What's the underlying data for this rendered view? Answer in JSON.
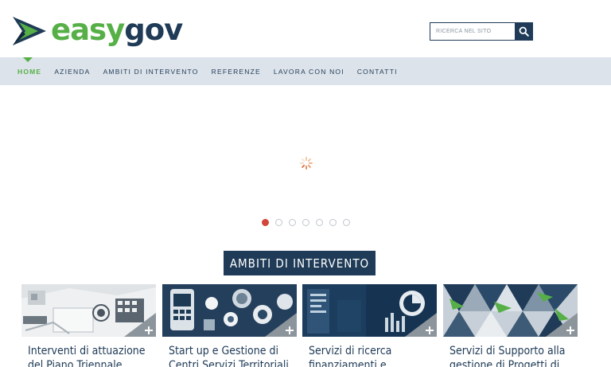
{
  "brand": {
    "easy": "easy",
    "gov": "gov",
    "green": "#56b047",
    "navy": "#1f3b57"
  },
  "search": {
    "placeholder": "RICERCA NEL SITO",
    "icon": "search-icon"
  },
  "nav": {
    "items": [
      {
        "label": "HOME",
        "active": true
      },
      {
        "label": "AZIENDA"
      },
      {
        "label": "AMBITI DI INTERVENTO"
      },
      {
        "label": "REFERENZE"
      },
      {
        "label": "LAVORA CON NOI"
      },
      {
        "label": "CONTATTI"
      }
    ]
  },
  "slider": {
    "dots": 7,
    "active_dot": 1,
    "loading": true
  },
  "section": {
    "title": "AMBITI DI INTERVENTO"
  },
  "cards": [
    {
      "title": "Interventi di attuazione del Piano Triennale"
    },
    {
      "title": "Start up e Gestione di Centri Servizi Territoriali"
    },
    {
      "title": "Servizi di ricerca finanziamenti e"
    },
    {
      "title": "Servizi di Supporto alla gestione di Progetti di"
    }
  ]
}
